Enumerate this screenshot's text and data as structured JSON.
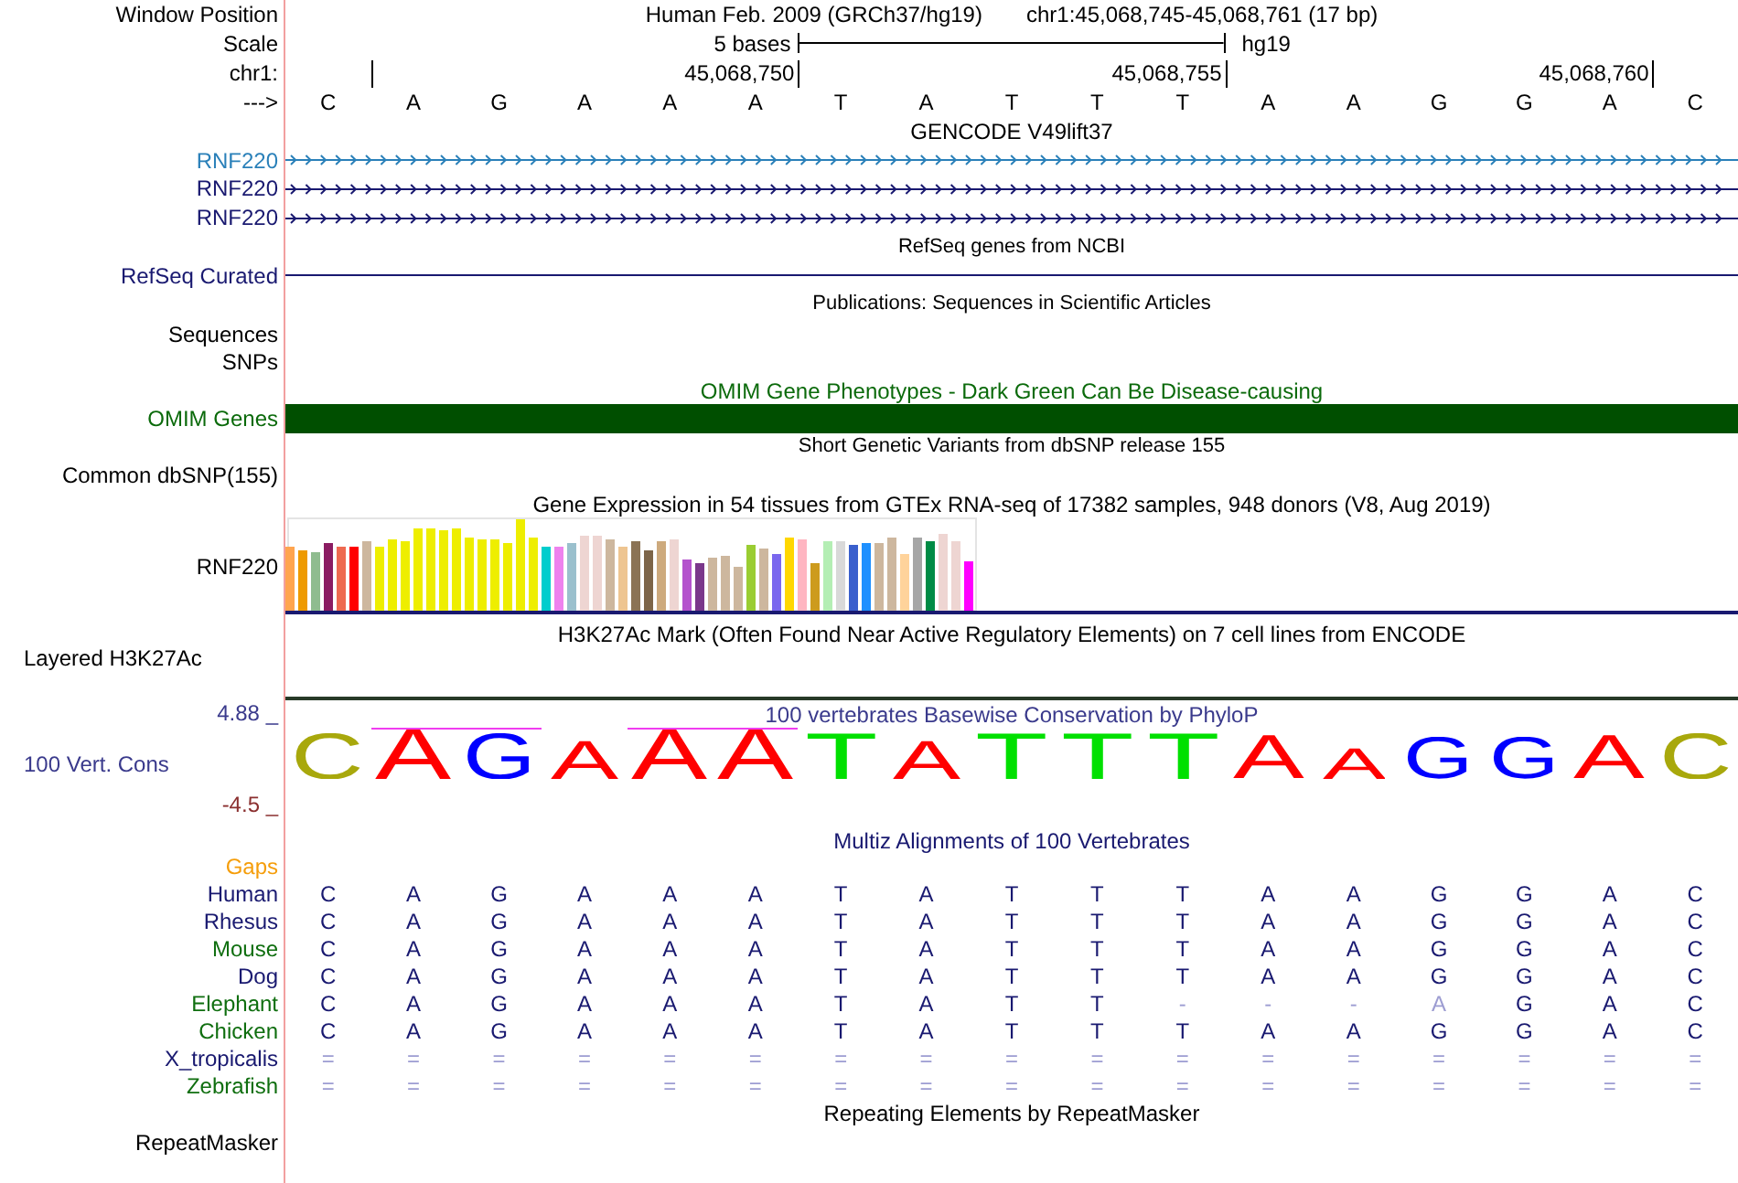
{
  "header": {
    "window_position": {
      "label": "Window Position",
      "assembly": "Human Feb. 2009 (GRCh37/hg19)",
      "range": "chr1:45,068,745-45,068,761 (17 bp)"
    },
    "scale": {
      "label": "Scale",
      "length": "5 bases",
      "assembly": "hg19"
    },
    "coordinates": {
      "label": "chr1:",
      "ticks": [
        "45,068,750",
        "45,068,755",
        "45,068,760"
      ]
    },
    "sequence": {
      "label": "--->",
      "bases": [
        "C",
        "A",
        "G",
        "A",
        "A",
        "A",
        "T",
        "A",
        "T",
        "T",
        "T",
        "A",
        "A",
        "G",
        "G",
        "A",
        "C"
      ]
    }
  },
  "tracks": [
    {
      "kind": "genes",
      "title": "GENCODE V49lift37",
      "rows": [
        {
          "label": "RNF220",
          "color": "#2a80b9"
        },
        {
          "label": "RNF220",
          "color": "#191970"
        },
        {
          "label": "RNF220",
          "color": "#191970"
        }
      ]
    },
    {
      "kind": "gene_line",
      "title": "RefSeq genes from NCBI",
      "label": "RefSeq Curated"
    },
    {
      "kind": "label_list",
      "title": "Publications: Sequences in Scientific Articles",
      "labels": [
        "Sequences",
        "SNPs"
      ]
    },
    {
      "kind": "bar",
      "title": "OMIM Gene Phenotypes - Dark Green Can Be Disease-causing",
      "label": "OMIM Genes"
    },
    {
      "kind": "variants",
      "title": "Short Genetic Variants from dbSNP release 155",
      "label": "Common dbSNP(155)"
    },
    {
      "kind": "expression",
      "title": "Gene Expression in 54 tissues from GTEx RNA-seq of 17382 samples, 948 donors (V8, Aug 2019)",
      "label": "RNF220"
    },
    {
      "kind": "layered",
      "title": "H3K27Ac Mark (Often Found Near Active Regulatory Elements) on 7 cell lines from ENCODE",
      "label": "Layered H3K27Ac"
    },
    {
      "kind": "conservation",
      "title": "100 vertebrates Basewise Conservation by PhyloP",
      "label": "100 Vert. Cons",
      "axis_top": "4.88 _",
      "axis_bottom": "-4.5 _",
      "letters": [
        {
          "base": "C",
          "color": "#a8a80c",
          "overline": false
        },
        {
          "base": "A",
          "color": "#ff0000",
          "overline": true
        },
        {
          "base": "G",
          "color": "#0000ff",
          "overline": true
        },
        {
          "base": "A",
          "color": "#ff0000",
          "overline": false
        },
        {
          "base": "A",
          "color": "#ff0000",
          "overline": true
        },
        {
          "base": "A",
          "color": "#ff0000",
          "overline": true
        },
        {
          "base": "T",
          "color": "#00e000",
          "overline": false
        },
        {
          "base": "A",
          "color": "#ff0000",
          "overline": false
        },
        {
          "base": "T",
          "color": "#00e000",
          "overline": false
        },
        {
          "base": "T",
          "color": "#00e000",
          "overline": false
        },
        {
          "base": "T",
          "color": "#00e000",
          "overline": false
        },
        {
          "base": "A",
          "color": "#ff0000",
          "overline": false
        },
        {
          "base": "A",
          "color": "#ff0000",
          "overline": false
        },
        {
          "base": "G",
          "color": "#0000ff",
          "overline": false
        },
        {
          "base": "G",
          "color": "#0000ff",
          "overline": false
        },
        {
          "base": "A",
          "color": "#ff0000",
          "overline": false
        },
        {
          "base": "C",
          "color": "#a8a80c",
          "overline": false
        }
      ]
    },
    {
      "kind": "alignment",
      "title": "Multiz Alignments of 100 Vertebrates",
      "gaps_label": "Gaps",
      "species": [
        {
          "name": "Human",
          "color": "#191970",
          "bases": [
            "C",
            "A",
            "G",
            "A",
            "A",
            "A",
            "T",
            "A",
            "T",
            "T",
            "T",
            "A",
            "A",
            "G",
            "G",
            "A",
            "C"
          ],
          "faint": [
            false,
            false,
            false,
            false,
            false,
            false,
            false,
            false,
            false,
            false,
            false,
            false,
            false,
            false,
            false,
            false,
            false
          ]
        },
        {
          "name": "Rhesus",
          "color": "#191970",
          "bases": [
            "C",
            "A",
            "G",
            "A",
            "A",
            "A",
            "T",
            "A",
            "T",
            "T",
            "T",
            "A",
            "A",
            "G",
            "G",
            "A",
            "C"
          ],
          "faint": [
            false,
            false,
            false,
            false,
            false,
            false,
            false,
            false,
            false,
            false,
            false,
            false,
            false,
            false,
            false,
            false,
            false
          ]
        },
        {
          "name": "Mouse",
          "color": "#0f6e0f",
          "bases": [
            "C",
            "A",
            "G",
            "A",
            "A",
            "A",
            "T",
            "A",
            "T",
            "T",
            "T",
            "A",
            "A",
            "G",
            "G",
            "A",
            "C"
          ],
          "faint": [
            false,
            false,
            false,
            false,
            false,
            false,
            false,
            false,
            false,
            false,
            false,
            false,
            false,
            false,
            false,
            false,
            false
          ]
        },
        {
          "name": "Dog",
          "color": "#191970",
          "bases": [
            "C",
            "A",
            "G",
            "A",
            "A",
            "A",
            "T",
            "A",
            "T",
            "T",
            "T",
            "A",
            "A",
            "G",
            "G",
            "A",
            "C"
          ],
          "faint": [
            false,
            false,
            false,
            false,
            false,
            false,
            false,
            false,
            false,
            false,
            false,
            false,
            false,
            false,
            false,
            false,
            false
          ]
        },
        {
          "name": "Elephant",
          "color": "#0f6e0f",
          "bases": [
            "C",
            "A",
            "G",
            "A",
            "A",
            "A",
            "T",
            "A",
            "T",
            "T",
            "-",
            "-",
            "-",
            "A",
            "G",
            "A",
            "C"
          ],
          "faint": [
            false,
            false,
            false,
            false,
            false,
            false,
            false,
            false,
            false,
            false,
            true,
            true,
            true,
            true,
            false,
            false,
            false
          ]
        },
        {
          "name": "Chicken",
          "color": "#0f6e0f",
          "bases": [
            "C",
            "A",
            "G",
            "A",
            "A",
            "A",
            "T",
            "A",
            "T",
            "T",
            "T",
            "A",
            "A",
            "G",
            "G",
            "A",
            "C"
          ],
          "faint": [
            false,
            false,
            false,
            false,
            false,
            false,
            false,
            false,
            false,
            false,
            false,
            false,
            false,
            false,
            false,
            false,
            false
          ]
        },
        {
          "name": "X_tropicalis",
          "color": "#191970",
          "bases": [
            "=",
            "=",
            "=",
            "=",
            "=",
            "=",
            "=",
            "=",
            "=",
            "=",
            "=",
            "=",
            "=",
            "=",
            "=",
            "=",
            "="
          ],
          "faint": [
            true,
            true,
            true,
            true,
            true,
            true,
            true,
            true,
            true,
            true,
            true,
            true,
            true,
            true,
            true,
            true,
            true
          ]
        },
        {
          "name": "Zebrafish",
          "color": "#0f6e0f",
          "bases": [
            "=",
            "=",
            "=",
            "=",
            "=",
            "=",
            "=",
            "=",
            "=",
            "=",
            "=",
            "=",
            "=",
            "=",
            "=",
            "=",
            "="
          ],
          "faint": [
            true,
            true,
            true,
            true,
            true,
            true,
            true,
            true,
            true,
            true,
            true,
            true,
            true,
            true,
            true,
            true,
            true
          ]
        }
      ]
    },
    {
      "kind": "repeats",
      "title": "Repeating Elements by RepeatMasker",
      "label": "RepeatMasker"
    }
  ]
}
